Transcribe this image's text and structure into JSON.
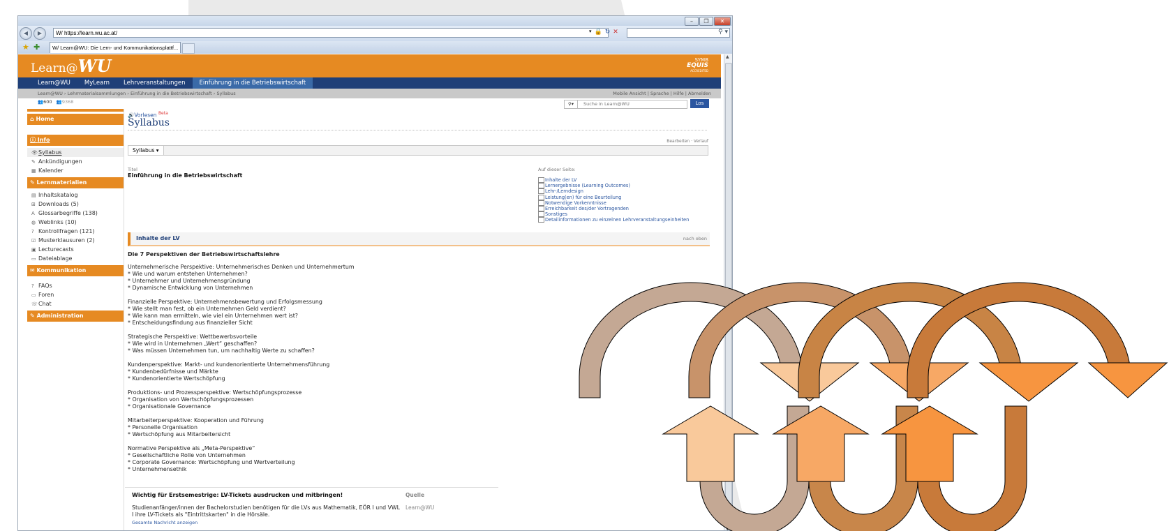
{
  "browser": {
    "url": "https://learn.wu.ac.at/",
    "tab_title": "Learn@WU: Die Lern- und Kommunikationsplattf..."
  },
  "site": {
    "logo_text": "Learn@",
    "logo_mark": "WU",
    "equis_top": "SYMB",
    "equis_main": "EQUIS",
    "equis_sub": "ACCREDITED"
  },
  "mainnav": [
    "Learn@WU",
    "MyLearn",
    "Lehrveranstaltungen",
    "Einführung in die Betriebswirtschaft"
  ],
  "breadcrumb": "Learn@WU › Lehrmaterialsammlungen › Einführung in die Betriebswirtschaft › Syllabus",
  "toplinks": "Mobile Ansicht  |  Sprache  |  Hilfe  |  Abmelden",
  "stats": {
    "users": "600",
    "visits": "9368"
  },
  "search": {
    "placeholder": "Suche in Learn@WU",
    "button": "Los"
  },
  "sidebar": {
    "home": "Home",
    "info": "Info",
    "info_items": [
      "Syllabus",
      "Ankündigungen",
      "Kalender"
    ],
    "lern": "Lernmaterialien",
    "lern_items": [
      "Inhaltskatalog",
      "Downloads (5)",
      "Glossarbegriffe (138)",
      "Weblinks (10)",
      "Kontrollfragen (121)",
      "Musterklausuren (2)",
      "Lecturecasts",
      "Dateiablage"
    ],
    "komm": "Kommunikation",
    "komm_items": [
      "FAQs",
      "Foren",
      "Chat"
    ],
    "admin": "Administration"
  },
  "page": {
    "vorlesen": "Vorlesen",
    "beta": "Beta",
    "title": "Syllabus",
    "editlinks": "Bearbeiten · Verlauf",
    "syllabus_btn": "Syllabus ▾",
    "titel_label": "Titel",
    "titel_value": "Einführung in die Betriebswirtschaft",
    "onpage_label": "Auf dieser Seite:",
    "onpage_links": [
      "Inhalte der LV",
      "Lernergebnisse (Learning Outcomes)",
      "Lehr-/Lerndesign",
      "Leistung(en) für eine Beurteilung",
      "Notwendige Vorkenntnisse",
      "Erreichbarkeit des/der Vortragenden",
      "Sonstiges",
      "Detailinformationen zu einzelnen Lehrveranstaltungseinheiten"
    ],
    "section_title": "Inhalte der LV",
    "section_top": "nach oben",
    "body_heading": "Die 7 Perspektiven der Betriebswirtschaftslehre",
    "body_text": "Unternehmerische Perspektive: Unternehmerisches Denken und Unternehmertum\n* Wie und warum entstehen Unternehmen?\n* Unternehmer und Unternehmensgründung\n* Dynamische Entwicklung von Unternehmen\n\nFinanzielle Perspektive: Unternehmensbewertung und Erfolgsmessung\n* Wie stellt man fest, ob ein Unternehmen Geld verdient?\n* Wie kann man ermitteln, wie viel ein Unternehmen wert ist?\n* Entscheidungsfindung aus finanzieller Sicht\n\nStrategische Perspektive: Wettbewerbsvorteile\n* Wie wird in Unternehmen „Wert“ geschaffen?\n* Was müssen Unternehmen tun, um nachhaltig Werte zu schaffen?\n\nKundenperspektive: Markt- und kundenorientierte Unternehmensführung\n* Kundenbedürfnisse und Märkte\n* Kundenorientierte Wertschöpfung\n\nProduktions- und Prozessperspektive: Wertschöpfungsprozesse\n* Organisation von Wertschöpfungsprozessen\n* Organisationale Governance\n\nMitarbeiterperspektive: Kooperation und Führung\n* Personelle Organisation\n* Wertschöpfung aus Mitarbeitersicht\n\nNormative Perspektive als „Meta-Perspektive“\n* Gesellschaftliche Rolle von Unternehmen\n* Corporate Governance: Wertschöpfung und Wertverteilung\n* Unternehmensethik"
  },
  "notice": {
    "heading": "Wichtig für Erstsemestrige: LV-Tickets ausdrucken und mitbringen!",
    "quelle_label": "Quelle",
    "quelle_value": "Learn@WU",
    "body": "Studienanfänger/innen der Bachelorstudien benötigen für die LVs aus Mathematik, EÖR I und VWL I ihre LV-Tickets als \"Eintrittskarten\" in die Hörsäle.",
    "link": "Gesamte Nachricht anzeigen"
  },
  "colors": {
    "orange": "#e68a22",
    "navy": "#1f3f78",
    "arrow_1": "#c4a894",
    "arrow_2": "#c8936a",
    "arrow_3": "#c88445",
    "arrow_4": "#c87a3a",
    "arrow_light": "#f9c99b",
    "arrow_mid": "#f7a865",
    "arrow_bright": "#f79540"
  }
}
